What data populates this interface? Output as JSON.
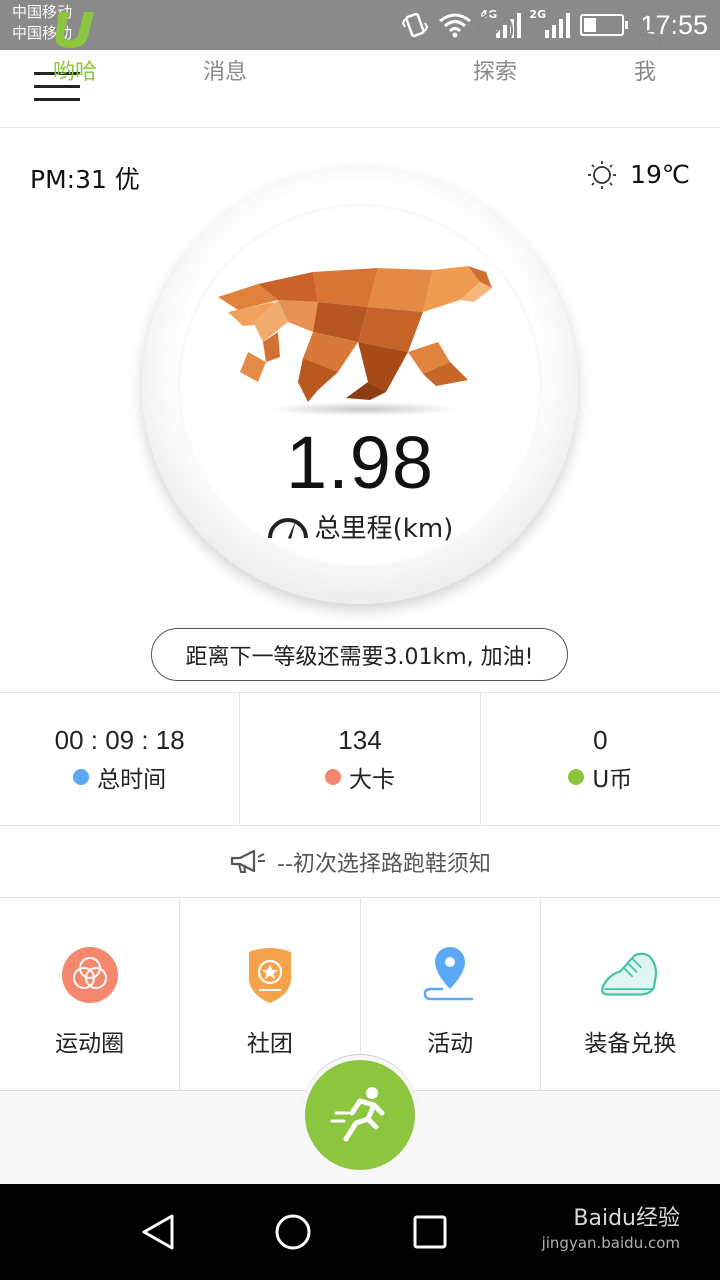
{
  "status_bar": {
    "carrier_1": "中国移动",
    "carrier_2": "中国移动",
    "network_1": "4G",
    "network_2": "2G",
    "time": "17:55"
  },
  "header": {
    "menu_icon": "hamburger-icon"
  },
  "hero": {
    "air_quality": "PM:31 优",
    "temperature": "19℃",
    "weather_icon": "sun-icon",
    "distance": "1.98",
    "distance_label": "总里程(km)",
    "tip": "距离下一等级还需要3.01km, 加油!"
  },
  "stats": [
    {
      "value": "00 : 09 : 18",
      "label": "总时间",
      "color": "#5aa9f5"
    },
    {
      "value": "134",
      "label": "大卡",
      "color": "#f4876e"
    },
    {
      "value": "0",
      "label": "U币",
      "color": "#8cc63f"
    }
  ],
  "notice": {
    "text": "--初次选择路跑鞋须知",
    "icon": "megaphone-icon"
  },
  "features": [
    {
      "label": "运动圈",
      "icon": "circles-icon"
    },
    {
      "label": "社团",
      "icon": "badge-icon"
    },
    {
      "label": "活动",
      "icon": "location-pin-icon"
    },
    {
      "label": "装备兑换",
      "icon": "shoe-icon"
    }
  ],
  "tabs": [
    {
      "label": "哟哈",
      "icon": "u-logo-icon",
      "active": true
    },
    {
      "label": "消息",
      "icon": "chat-bubble-icon"
    },
    {
      "label": "探索",
      "icon": "compass-icon"
    },
    {
      "label": "我",
      "icon": "user-icon"
    }
  ],
  "colors": {
    "accent": "#8cc63f"
  },
  "watermark": {
    "brand": "Baidu经验",
    "url": "jingyan.baidu.com"
  }
}
